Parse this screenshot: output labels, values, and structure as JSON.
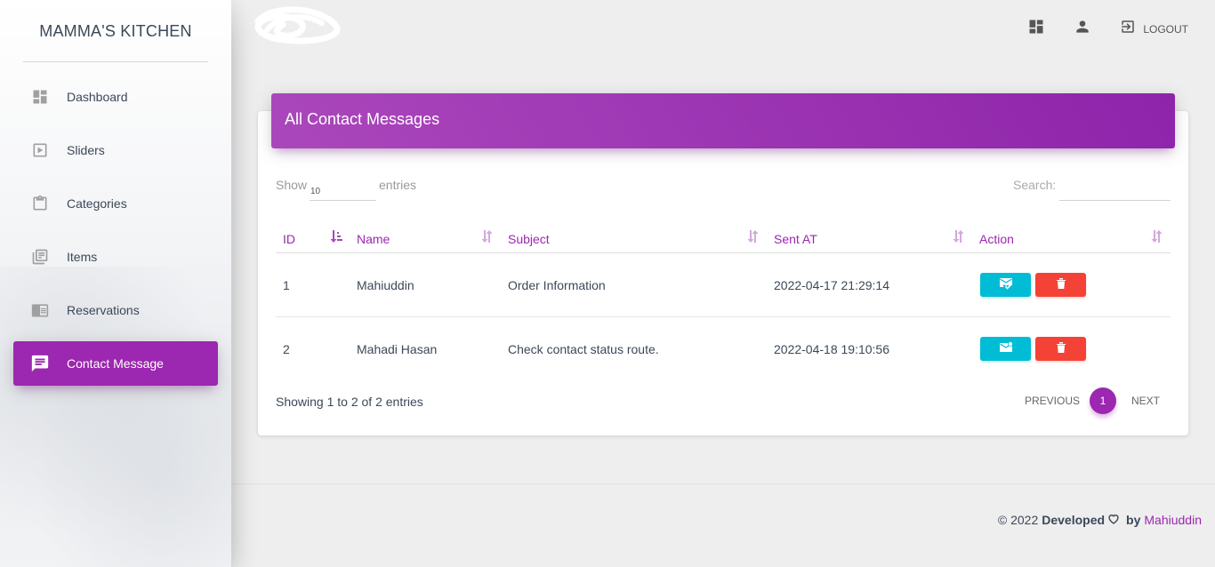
{
  "brand": {
    "name": "MAMMA'S KITCHEN"
  },
  "sidebar": {
    "items": [
      {
        "label": "Dashboard",
        "icon": "dashboard-icon",
        "active": false
      },
      {
        "label": "Sliders",
        "icon": "slider-icon",
        "active": false
      },
      {
        "label": "Categories",
        "icon": "clipboard-icon",
        "active": false
      },
      {
        "label": "Items",
        "icon": "library-books-icon",
        "active": false
      },
      {
        "label": "Reservations",
        "icon": "chrome-reader-icon",
        "active": false
      },
      {
        "label": "Contact Message",
        "icon": "chat-icon",
        "active": true
      }
    ]
  },
  "topbar": {
    "logout_label": "LOGOUT"
  },
  "card": {
    "title": "All Contact Messages"
  },
  "table_controls": {
    "show_label": "Show",
    "entries_value": "10",
    "entries_label": "entries",
    "search_label": "Search:",
    "search_value": ""
  },
  "table": {
    "columns": [
      "ID",
      "Name",
      "Subject",
      "Sent AT",
      "Action"
    ],
    "rows": [
      {
        "id": "1",
        "name": "Mahiuddin",
        "subject": "Order Information",
        "sent_at": "2022-04-17 21:29:14"
      },
      {
        "id": "2",
        "name": "Mahadi Hasan",
        "subject": "Check contact status route.",
        "sent_at": "2022-04-18 19:10:56"
      }
    ]
  },
  "pagination": {
    "info": "Showing 1 to 2 of 2 entries",
    "previous": "PREVIOUS",
    "current": "1",
    "next": "NEXT"
  },
  "footer": {
    "copyright": "© 2022",
    "developed": "Developed",
    "by": "by",
    "author": "Mahiuddin"
  },
  "colors": {
    "primary": "#9c27b0",
    "info": "#00bcd4",
    "danger": "#f44336"
  }
}
